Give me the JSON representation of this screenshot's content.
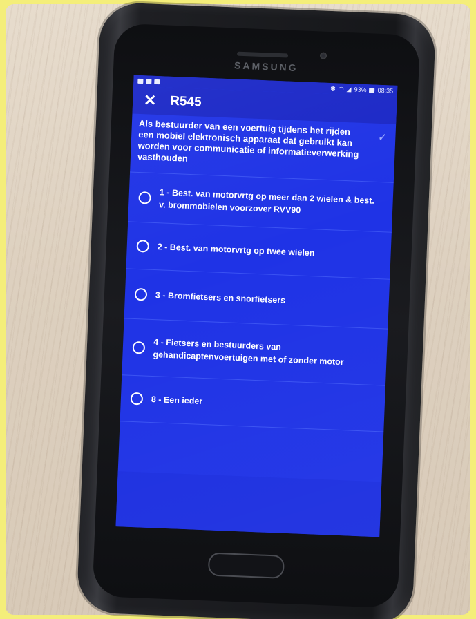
{
  "device": {
    "brand": "SAMSUNG"
  },
  "status_bar": {
    "battery": "93%",
    "time": "08:35"
  },
  "toolbar": {
    "close_icon": "close-icon",
    "title": "R545"
  },
  "question": {
    "text": "Als bestuurder van een voertuig tijdens het rijden een mobiel elektronisch apparaat dat gebruikt kan worden voor communicatie of informatieverwerking vasthouden",
    "confirm_icon": "check-icon"
  },
  "answers": [
    {
      "label": "1 - Best. van motorvrtg op meer dan 2 wielen & best. v. brommobielen voorzover RVV90"
    },
    {
      "label": "2 - Best. van motorvrtg op twee wielen"
    },
    {
      "label": "3 - Bromfietsers en snorfietsers"
    },
    {
      "label": "4 - Fietsers en bestuurders van gehandicaptenvoertuigen met of zonder motor"
    },
    {
      "label": "8 - Een ieder"
    }
  ],
  "colors": {
    "screen": "#1f33e6",
    "toolbar": "#1a27c7",
    "frame": "#f4ee7a"
  }
}
